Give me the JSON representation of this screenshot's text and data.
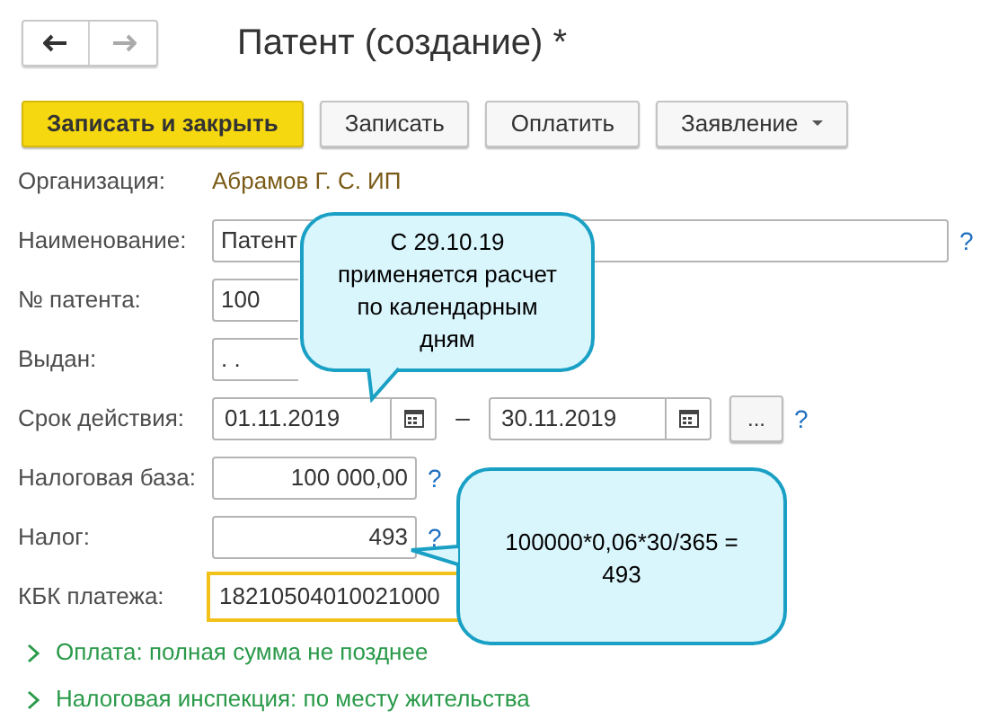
{
  "nav": {
    "back": {
      "disabled": false
    },
    "forward": {
      "disabled": true
    }
  },
  "title": "Патент (создание) *",
  "toolbar": [
    {
      "kind": "primary",
      "label": "Записать и закрыть"
    },
    {
      "kind": "normal",
      "label": "Записать"
    },
    {
      "kind": "normal",
      "label": "Оплатить"
    },
    {
      "kind": "dropdown",
      "label": "Заявление"
    }
  ],
  "rows": [
    {
      "kind": "static",
      "label": "Организация:",
      "value": "Абрамов Г. С. ИП"
    },
    {
      "kind": "wide",
      "label": "Наименование:",
      "value": "Патент",
      "help": "?"
    },
    {
      "kind": "short",
      "label": "№ патента:",
      "value": "100"
    },
    {
      "kind": "short",
      "label": "Выдан:",
      "value": ". ."
    },
    {
      "kind": "period",
      "label": "Срок действия:",
      "from": "01.11.2019",
      "dash": "–",
      "to": "30.11.2019",
      "more": "...",
      "help": "?"
    },
    {
      "kind": "amount",
      "label": "Налоговая база:",
      "value": "100 000,00",
      "help": "?"
    },
    {
      "kind": "amount",
      "label": "Налог:",
      "value": "493",
      "help": "?"
    },
    {
      "kind": "focused",
      "label": "КБК платежа:",
      "value": "18210504010021000"
    }
  ],
  "sections": [
    {
      "label": "Оплата: полная сумма не позднее",
      "expanded": false
    },
    {
      "label": "Налоговая инспекция: по месту жительства",
      "expanded": false
    }
  ],
  "callouts": [
    {
      "kind": "below",
      "text": "С 29.10.19 применяется расчет по календарным дням"
    },
    {
      "kind": "left",
      "text": "100000*0,06*30/365 = 493"
    }
  ]
}
